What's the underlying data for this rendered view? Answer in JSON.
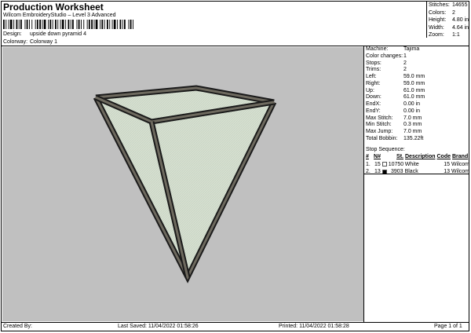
{
  "header": {
    "title": "Production Worksheet",
    "subtitle": "Wilcom EmbroideryStudio – Level 3 Advanced",
    "design_label": "Design:",
    "design_value": "upside down pyramid 4",
    "colorway_label": "Colorway:",
    "colorway_value": "Colorway 1"
  },
  "summary": {
    "stitches_label": "Stitches:",
    "stitches": "14655",
    "colors_label": "Colors:",
    "colors": "2",
    "height_label": "Height:",
    "height": "4.80 in",
    "width_label": "Width:",
    "width": "4.64 in",
    "zoom_label": "Zoom:",
    "zoom": "1:1"
  },
  "details": [
    {
      "label": "Machine:",
      "value": "Tajima"
    },
    {
      "label": "Color changes:",
      "value": "1"
    },
    {
      "label": "Stops:",
      "value": "2"
    },
    {
      "label": "Trims:",
      "value": "2"
    },
    {
      "label": "Left:",
      "value": "59.0 mm"
    },
    {
      "label": "Right:",
      "value": "59.0 mm"
    },
    {
      "label": "Up:",
      "value": "61.0 mm"
    },
    {
      "label": "Down:",
      "value": "61.0 mm"
    },
    {
      "label": "EndX:",
      "value": "0.00 in"
    },
    {
      "label": "EndY:",
      "value": "0.00 in"
    },
    {
      "label": "Max Stitch:",
      "value": "7.0 mm"
    },
    {
      "label": "Min Stitch:",
      "value": "0.3 mm"
    },
    {
      "label": "Max Jump:",
      "value": "7.0 mm"
    },
    {
      "label": "Total Bobbin:",
      "value": "135.22ft"
    }
  ],
  "stop_sequence": {
    "title": "Stop Sequence:",
    "headers": {
      "num": "#",
      "n": "N#",
      "st": "St.",
      "description": "Description",
      "code": "Code",
      "brand": "Brand"
    },
    "rows": [
      {
        "num": "1.",
        "n": "15",
        "swatch": "#ffffff",
        "st": "10750",
        "description": "White",
        "code": "15",
        "brand": "Wilcom"
      },
      {
        "num": "2.",
        "n": "13",
        "swatch": "#000000",
        "st": "3903",
        "description": "Black",
        "code": "13",
        "brand": "Wilcom"
      }
    ]
  },
  "footer": {
    "created_by": "Created By:",
    "last_saved": "Last Saved: 11/04/2022 01:58:26",
    "printed": "Printed: 11/04/2022 01:58:28",
    "page": "Page 1 of 1"
  },
  "colors": {
    "canvas_bg": "#c0c0c0",
    "fill": "#d9e3d3",
    "outline": "#1a1a1a",
    "outline_inner": "#6e6a5f"
  }
}
